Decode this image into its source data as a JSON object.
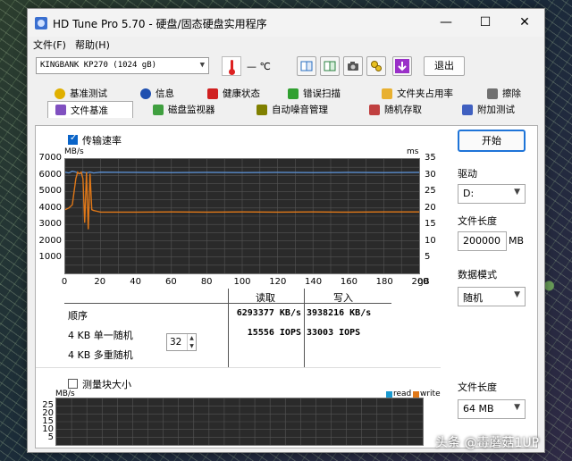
{
  "window": {
    "title": "HD Tune Pro 5.70 - 硬盘/固态硬盘实用程序"
  },
  "menu": [
    {
      "label": "文件(F)"
    },
    {
      "label": "帮助(H)"
    }
  ],
  "toolbar": {
    "drive": "KINGBANK KP270 (1024 gB)",
    "temperature": "— ℃",
    "exit_label": "退出",
    "icons": [
      "copy-text-icon",
      "copy-info-icon",
      "camera-icon",
      "options-icon",
      "download-icon"
    ]
  },
  "tabs_row1": [
    {
      "label": "基准测试",
      "icon": "benchmark-icon",
      "color": "#e0b000"
    },
    {
      "label": "信息",
      "icon": "info-icon",
      "color": "#1e4fb0"
    },
    {
      "label": "健康状态",
      "icon": "health-icon",
      "color": "#d02020"
    },
    {
      "label": "错误扫描",
      "icon": "error-scan-icon",
      "color": "#30a030"
    },
    {
      "label": "文件夹占用率",
      "icon": "folder-icon",
      "color": "#e8b030"
    },
    {
      "label": "擦除",
      "icon": "trash-icon",
      "color": "#707070"
    }
  ],
  "tabs_row2": [
    {
      "label": "文件基准",
      "icon": "file-benchmark-icon",
      "color": "#8050c0",
      "active": true
    },
    {
      "label": "磁盘监视器",
      "icon": "monitor-icon",
      "color": "#40a040"
    },
    {
      "label": "自动噪音管理",
      "icon": "speaker-icon",
      "color": "#808000"
    },
    {
      "label": "随机存取",
      "icon": "random-access-icon",
      "color": "#c04040"
    },
    {
      "label": "附加测试",
      "icon": "extra-tests-icon",
      "color": "#4060c0"
    }
  ],
  "transfer": {
    "checkbox_label": "传输速率",
    "checked": true
  },
  "chart_data": {
    "type": "line",
    "y_unit": "MB/s",
    "y2_unit": "ms",
    "x_unit": "gB",
    "yticks": [
      "7000",
      "6000",
      "5000",
      "4000",
      "3000",
      "2000",
      "1000"
    ],
    "y2ticks": [
      "35",
      "30",
      "25",
      "20",
      "15",
      "10",
      "5"
    ],
    "xticks": [
      "0",
      "20",
      "40",
      "60",
      "80",
      "100",
      "120",
      "140",
      "160",
      "180",
      "200"
    ],
    "ylim": [
      0,
      7000
    ],
    "xlim": [
      0,
      200
    ],
    "grid": true,
    "series": [
      {
        "color": "#5a8ed0",
        "x": [
          0,
          2,
          4,
          6,
          8,
          10,
          12,
          14,
          16,
          20,
          40,
          60,
          80,
          100,
          120,
          140,
          160,
          180,
          200
        ],
        "y": [
          6200,
          6150,
          6250,
          6200,
          6100,
          6200,
          6150,
          6200,
          6150,
          6200,
          6180,
          6170,
          6180,
          6170,
          6180,
          6170,
          6180,
          6170,
          6180
        ]
      },
      {
        "color": "#e07818",
        "x": [
          0,
          2,
          4,
          6,
          7,
          8,
          9,
          10,
          11,
          12,
          13,
          14,
          15,
          16,
          18,
          20,
          40,
          60,
          80,
          100,
          120,
          140,
          160,
          180,
          200
        ],
        "y": [
          3900,
          4000,
          4200,
          5800,
          6200,
          6100,
          6200,
          5800,
          3100,
          6200,
          2700,
          6100,
          3900,
          3850,
          3800,
          3750,
          3750,
          3760,
          3750,
          3760,
          3750,
          3760,
          3750,
          3760,
          3760
        ]
      }
    ]
  },
  "results": {
    "col_read": "读取",
    "col_write": "写入",
    "rows": [
      {
        "label": "顺序",
        "read": "6293377 KB/s",
        "write": "3938216 KB/s"
      },
      {
        "label": "4 KB 单一随机",
        "read": "15556 IOPS",
        "write": "33003 IOPS"
      },
      {
        "label": "4 KB 多重随机",
        "read": "",
        "write": ""
      }
    ],
    "queue_depth": "32"
  },
  "block": {
    "checkbox_label": "测量块大小",
    "checked": false,
    "y_unit": "MB/s",
    "yticks": [
      "25",
      "20",
      "15",
      "10",
      "5"
    ],
    "legend_read": "read",
    "legend_write": "write",
    "read_color": "#1a9ad0",
    "write_color": "#e07818"
  },
  "side": {
    "start_label": "开始",
    "drive_label": "驱动",
    "drive_value": "D:",
    "file_length_label": "文件长度",
    "file_length_value": "200000",
    "file_length_unit": "MB",
    "data_mode_label": "数据模式",
    "data_mode_value": "随机",
    "block_length_label": "文件长度",
    "block_length_value": "64 MB"
  },
  "watermark": "头条 @毒蘑菇1UP"
}
